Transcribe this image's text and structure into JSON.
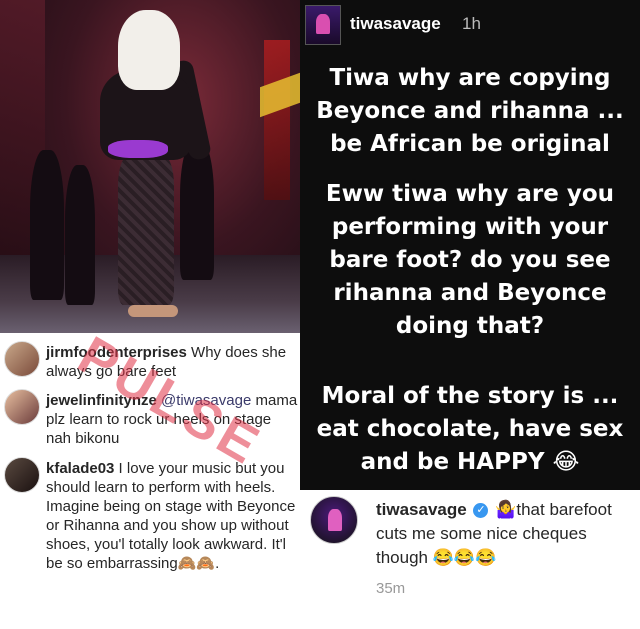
{
  "watermark": {
    "text": "PULSE"
  },
  "comments": [
    {
      "user": "jirmfoodenterprises",
      "text": " Why does she always go bare feet"
    },
    {
      "user": "jewelinfinitynze",
      "mention": " @tiwasavage",
      "text": " mama plz learn to rock ur heels on stage nah bikonu"
    },
    {
      "user": "kfalade03",
      "text": " I love your music but you should learn to perform with heels. Imagine being on stage with Beyonce or Rihanna and you show up without shoes, you'l totally look awkward. It'l be so embarrassing🙈🙈."
    }
  ],
  "story": {
    "user": "tiwasavage",
    "time": "1h",
    "blocks": [
      "Tiwa why are copying Beyonce and rihanna ... be African be original",
      "Eww tiwa why are you performing with your bare foot? do you see rihanna and Beyonce doing that?",
      "Moral of the story is ... eat chocolate, have sex and be HAPPY 😂"
    ]
  },
  "reply": {
    "user": "tiwasavage",
    "verified_icon": "✓",
    "text": " 🤷‍♀️that barefoot cuts me some nice cheques though 😂😂😂",
    "time": "35m"
  }
}
